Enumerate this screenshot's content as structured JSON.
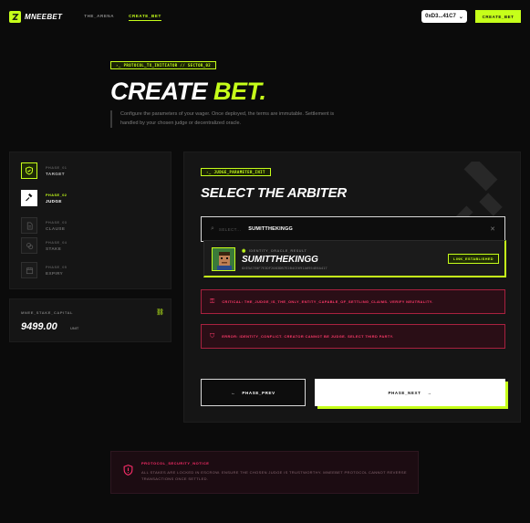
{
  "nav": {
    "logo": "MNEEBET",
    "links": [
      {
        "label": "THE_ARENA"
      },
      {
        "label": "CREATE_BET"
      }
    ],
    "wallet": "0xD3...41C7",
    "create_button": "CREATE_BET"
  },
  "hero": {
    "tag": "PROTOCOL_TX_INITIATOR // SECTOR_02",
    "title_a": "CREATE",
    "title_b": "BET.",
    "description": "Configure the parameters of your wager. Once deployed, the terms are immutable. Settlement is handled by your chosen judge or decentralized oracle."
  },
  "phases": [
    {
      "num": "PHASE_01",
      "name": "TARGET",
      "state": "done",
      "icon": "shield-icon"
    },
    {
      "num": "PHASE_02",
      "name": "JUDGE",
      "state": "active",
      "icon": "gavel-icon"
    },
    {
      "num": "PHASE_03",
      "name": "CLAUSE",
      "state": "pending",
      "icon": "document-icon"
    },
    {
      "num": "PHASE_04",
      "name": "STAKE",
      "state": "pending",
      "icon": "coins-icon"
    },
    {
      "num": "PHASE_05",
      "name": "EXPIRY",
      "state": "pending",
      "icon": "calendar-icon"
    }
  ],
  "capital": {
    "label": "MNEE_STAKE_CAPITAL",
    "value": "9499.00",
    "unit": "UNIT"
  },
  "main": {
    "tag": "JUDGE_PARAMETER_INIT",
    "title": "SELECT THE ARBITER",
    "search": {
      "placeholder": "SELECT...",
      "value": "SUMITTHEKINGG"
    },
    "result": {
      "id_label": "IDENTITY_ORACLE_RESULT",
      "name": "SUMITTHEKINGG",
      "address": "0XE5A7E0F7E3DF2083DB7E2B4CE691A6954E6A417",
      "badge": "LINK_ESTABLISHED"
    },
    "alerts": [
      {
        "text": "CRITICAL: THE_JUDGE_IS_THE_ONLY_ENTITY_CAPABLE_OF_SETTLING_CLAIMS. VERIFY NEUTRALITY."
      },
      {
        "text": "ERROR: IDENTITY_CONFLICT. CREATOR CANNOT BE JUDGE. SELECT THIRD PARTY."
      }
    ],
    "prev_label": "PHASE_PREV",
    "next_label": "PHASE_NEXT"
  },
  "notice": {
    "title": "PROTOCOL_SECURITY_NOTICE",
    "text": "ALL STAKES ARE LOCKED IN ESCROW. ENSURE THE CHOSEN JUDGE IS TRUSTWORTHY. MNEEBET PROTOCOL CANNOT REVERSE TRANSACTIONS ONCE SETTLED."
  },
  "colors": {
    "accent": "#c6ff1a",
    "danger": "#ff3a6a",
    "background": "#0b0b0b",
    "panel": "#151515"
  }
}
